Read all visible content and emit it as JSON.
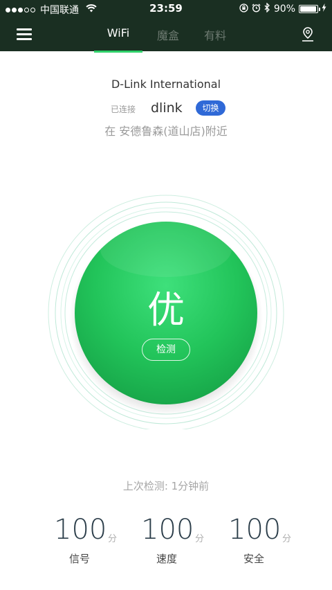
{
  "status_bar": {
    "carrier": "中国联通",
    "time": "23:59",
    "battery": "90%",
    "battery_level": 0.9,
    "signal_bars_filled": 3,
    "signal_bars_total": 5
  },
  "header": {
    "tabs": [
      {
        "label": "WiFi",
        "active": true
      },
      {
        "label": "魔盒",
        "active": false
      },
      {
        "label": "有料",
        "active": false
      }
    ],
    "menu_icon": "hamburger-menu-icon",
    "location_icon": "location-pin-icon"
  },
  "network": {
    "name": "D-Link International",
    "connected_label": "已连接",
    "ssid": "dlink",
    "switch_label": "切换",
    "location": "在 安德鲁森(道山店)附近"
  },
  "gauge": {
    "grade": "优",
    "check_label": "检测"
  },
  "last_check": "上次检测: 1分钟前",
  "stats": [
    {
      "value": "100",
      "unit": "分",
      "label": "信号"
    },
    {
      "value": "100",
      "unit": "分",
      "label": "速度"
    },
    {
      "value": "100",
      "unit": "分",
      "label": "安全"
    }
  ],
  "colors": {
    "header_bg": "#1a2f22",
    "accent_green": "#2fd16a",
    "button_blue": "#2f69d7"
  }
}
